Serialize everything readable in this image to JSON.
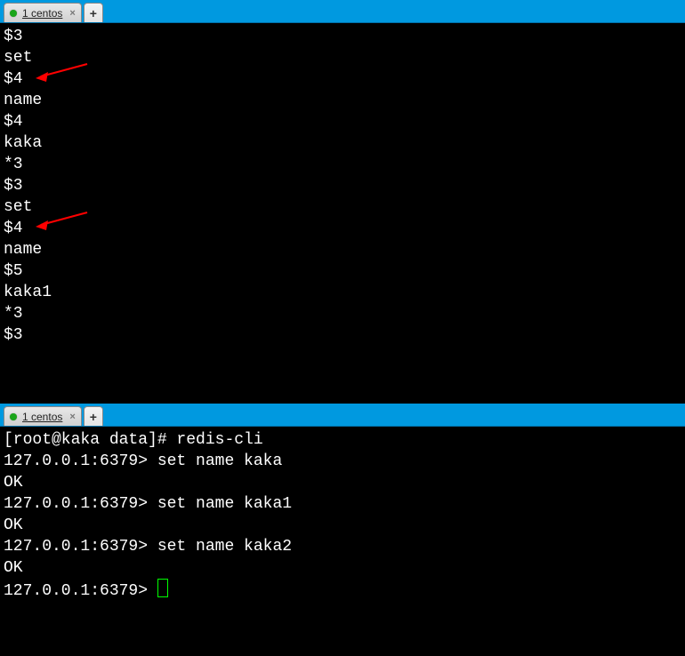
{
  "colors": {
    "title_bar": "#0099e0",
    "terminal_bg": "#000000",
    "terminal_fg": "#ffffff",
    "cursor": "#00ff00",
    "tab_dot": "#1aa51a",
    "arrow": "#ff0000"
  },
  "top_pane": {
    "tab": {
      "label": "1 centos"
    },
    "lines": [
      "$3",
      "set",
      "$4",
      "name",
      "$4",
      "kaka",
      "*3",
      "$3",
      "set",
      "$4",
      "name",
      "$5",
      "kaka1",
      "*3",
      "$3"
    ],
    "arrow_targets": [
      1,
      8
    ]
  },
  "bottom_pane": {
    "tab": {
      "label": "1 centos"
    },
    "lines": [
      "[root@kaka data]# redis-cli",
      "127.0.0.1:6379> set name kaka",
      "OK",
      "127.0.0.1:6379> set name kaka1",
      "OK",
      "127.0.0.1:6379> set name kaka2",
      "OK",
      "127.0.0.1:6379> "
    ],
    "cursor_line": 7
  }
}
